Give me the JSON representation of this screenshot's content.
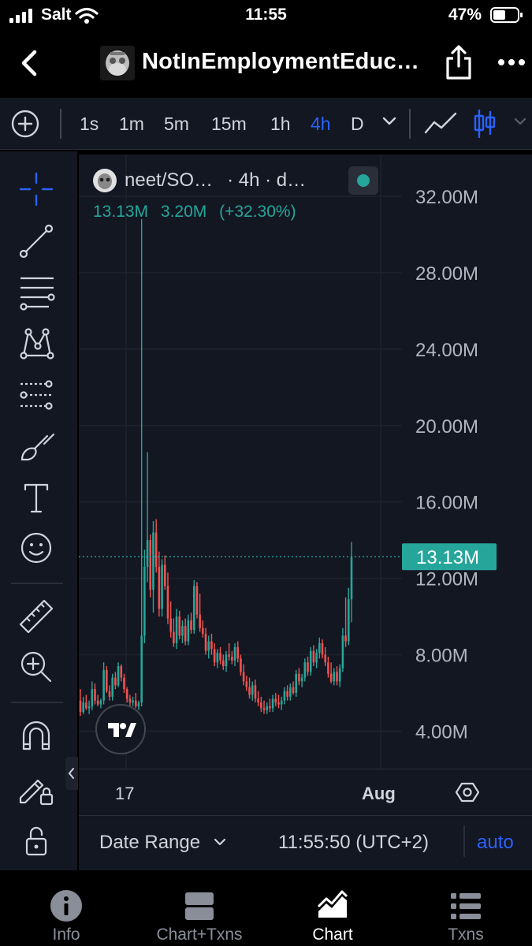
{
  "status_bar": {
    "carrier": "Salt",
    "time": "11:55",
    "battery_percent": "47%"
  },
  "header": {
    "title": "NotInEmploymentEduc…",
    "back_icon": "chevron-left-icon",
    "share_icon": "share-icon",
    "more_icon": "more-icon"
  },
  "toolbar": {
    "intervals": [
      "1s",
      "1m",
      "5m",
      "15m",
      "1h",
      "4h",
      "D"
    ],
    "active_interval": "4h"
  },
  "legend": {
    "symbol": "neet/SO…",
    "meta": "· 4h · d…",
    "ohlc": [
      "13.13M",
      "3.20M",
      "(+32.30%)"
    ]
  },
  "chart_data": {
    "type": "candlestick",
    "y_ticks": [
      "32.00M",
      "28.00M",
      "24.00M",
      "20.00M",
      "16.00M",
      "12.00M",
      "8.00M",
      "4.00M"
    ],
    "x_ticks": [
      "17",
      "Aug"
    ],
    "last_price_label": "13.13M",
    "last_price": 13.13,
    "ylim": [
      1.5,
      33.5
    ],
    "up_color": "#26a69a",
    "down_color": "#ef5350",
    "candles": [
      [
        5.6,
        6.2,
        4.8,
        5.0
      ],
      [
        5.0,
        5.8,
        4.9,
        5.5
      ],
      [
        5.5,
        5.9,
        5.1,
        5.2
      ],
      [
        5.2,
        5.6,
        4.9,
        5.3
      ],
      [
        5.3,
        6.6,
        5.1,
        6.2
      ],
      [
        6.2,
        6.5,
        5.4,
        5.6
      ],
      [
        5.6,
        5.9,
        5.3,
        5.4
      ],
      [
        5.4,
        5.7,
        5.2,
        5.6
      ],
      [
        5.6,
        7.6,
        5.4,
        7.2
      ],
      [
        7.2,
        7.4,
        6.0,
        6.1
      ],
      [
        6.1,
        6.4,
        5.6,
        5.8
      ],
      [
        5.8,
        7.0,
        5.6,
        6.8
      ],
      [
        6.8,
        7.1,
        6.2,
        6.4
      ],
      [
        6.4,
        7.6,
        6.3,
        7.4
      ],
      [
        7.4,
        7.5,
        6.6,
        6.8
      ],
      [
        6.8,
        7.0,
        6.0,
        6.2
      ],
      [
        6.2,
        6.3,
        5.5,
        5.7
      ],
      [
        5.7,
        5.9,
        5.2,
        5.5
      ],
      [
        5.5,
        5.8,
        5.3,
        5.6
      ],
      [
        5.6,
        6.0,
        5.2,
        5.3
      ],
      [
        5.3,
        5.6,
        5.1,
        5.5
      ],
      [
        5.5,
        30.8,
        5.3,
        9.0
      ],
      [
        9.0,
        13.5,
        8.6,
        12.6
      ],
      [
        12.6,
        18.6,
        11.8,
        14.0
      ],
      [
        14.0,
        14.3,
        11.0,
        11.4
      ],
      [
        11.4,
        15.0,
        10.2,
        14.4
      ],
      [
        14.4,
        15.1,
        12.3,
        12.6
      ],
      [
        12.6,
        13.4,
        10.0,
        10.4
      ],
      [
        10.4,
        13.0,
        10.0,
        12.7
      ],
      [
        12.7,
        13.2,
        11.4,
        11.6
      ],
      [
        11.6,
        12.3,
        9.6,
        9.9
      ],
      [
        9.9,
        10.8,
        8.9,
        9.2
      ],
      [
        9.2,
        9.9,
        8.4,
        8.6
      ],
      [
        8.6,
        10.4,
        8.3,
        10.0
      ],
      [
        10.0,
        10.3,
        8.8,
        9.0
      ],
      [
        9.0,
        9.8,
        8.6,
        9.5
      ],
      [
        9.5,
        9.9,
        8.5,
        8.7
      ],
      [
        8.7,
        10.1,
        8.5,
        9.8
      ],
      [
        9.8,
        10.2,
        9.1,
        9.3
      ],
      [
        9.3,
        11.9,
        9.1,
        11.6
      ],
      [
        11.6,
        11.8,
        9.9,
        10.1
      ],
      [
        10.1,
        11.2,
        9.2,
        9.4
      ],
      [
        9.4,
        9.8,
        8.9,
        9.1
      ],
      [
        9.1,
        9.4,
        8.0,
        8.2
      ],
      [
        8.2,
        9.0,
        7.8,
        8.7
      ],
      [
        8.7,
        9.1,
        8.0,
        8.3
      ],
      [
        8.3,
        8.6,
        7.4,
        7.6
      ],
      [
        7.6,
        8.3,
        7.3,
        8.1
      ],
      [
        8.1,
        8.4,
        7.5,
        7.7
      ],
      [
        7.7,
        8.0,
        7.2,
        7.4
      ],
      [
        7.4,
        8.2,
        7.1,
        8.0
      ],
      [
        8.0,
        8.6,
        7.7,
        7.9
      ],
      [
        7.9,
        8.2,
        7.5,
        7.7
      ],
      [
        7.7,
        8.6,
        7.4,
        8.4
      ],
      [
        8.4,
        8.7,
        7.6,
        7.8
      ],
      [
        7.8,
        8.0,
        6.9,
        7.1
      ],
      [
        7.1,
        7.5,
        6.4,
        6.6
      ],
      [
        6.6,
        6.9,
        6.1,
        6.3
      ],
      [
        6.3,
        6.8,
        5.7,
        5.9
      ],
      [
        5.9,
        6.6,
        5.6,
        6.4
      ],
      [
        6.4,
        6.7,
        5.5,
        5.7
      ],
      [
        5.7,
        6.1,
        5.3,
        5.5
      ],
      [
        5.5,
        5.8,
        5.0,
        5.2
      ],
      [
        5.2,
        5.6,
        4.9,
        5.1
      ],
      [
        5.1,
        5.5,
        4.9,
        5.3
      ],
      [
        5.3,
        5.7,
        5.0,
        5.2
      ],
      [
        5.2,
        5.9,
        5.0,
        5.7
      ],
      [
        5.7,
        6.0,
        5.3,
        5.5
      ],
      [
        5.5,
        5.9,
        5.2,
        5.4
      ],
      [
        5.4,
        5.8,
        5.1,
        5.6
      ],
      [
        5.6,
        6.3,
        5.4,
        6.1
      ],
      [
        6.1,
        6.4,
        5.6,
        5.8
      ],
      [
        5.8,
        6.5,
        5.6,
        6.3
      ],
      [
        6.3,
        6.6,
        5.9,
        6.0
      ],
      [
        6.0,
        7.2,
        5.8,
        7.0
      ],
      [
        7.0,
        7.3,
        6.4,
        6.6
      ],
      [
        6.6,
        7.0,
        6.3,
        6.8
      ],
      [
        6.8,
        7.8,
        6.6,
        7.6
      ],
      [
        7.6,
        7.9,
        6.9,
        7.1
      ],
      [
        7.1,
        8.4,
        6.9,
        8.2
      ],
      [
        8.2,
        8.5,
        7.4,
        7.6
      ],
      [
        7.6,
        8.3,
        7.3,
        8.1
      ],
      [
        8.1,
        8.9,
        7.8,
        8.6
      ],
      [
        8.6,
        8.8,
        7.8,
        8.0
      ],
      [
        8.0,
        8.4,
        7.4,
        7.6
      ],
      [
        7.6,
        7.9,
        6.8,
        7.0
      ],
      [
        7.0,
        7.6,
        6.5,
        6.6
      ],
      [
        6.6,
        7.3,
        6.4,
        7.1
      ],
      [
        7.1,
        7.4,
        6.4,
        6.6
      ],
      [
        6.6,
        7.5,
        6.3,
        7.3
      ],
      [
        7.3,
        9.4,
        7.1,
        9.0
      ],
      [
        9.0,
        11.0,
        8.4,
        8.7
      ],
      [
        8.7,
        11.5,
        8.5,
        10.9
      ],
      [
        10.9,
        13.9,
        9.7,
        13.13
      ]
    ]
  },
  "left_tools": [
    {
      "name": "crosshair-icon"
    },
    {
      "name": "trend-line-icon"
    },
    {
      "name": "fib-retracement-icon"
    },
    {
      "name": "pattern-icon"
    },
    {
      "name": "prediction-icon"
    },
    {
      "name": "brush-icon"
    },
    {
      "name": "text-icon"
    },
    {
      "name": "emoji-icon"
    },
    {
      "name": "ruler-icon"
    },
    {
      "name": "zoom-in-icon"
    },
    {
      "name": "magnet-icon"
    },
    {
      "name": "lock-drawing-icon"
    },
    {
      "name": "lock-icon"
    }
  ],
  "bottom_bar": {
    "date_range_label": "Date Range",
    "clock": "11:55:50 (UTC+2)",
    "auto_label": "auto"
  },
  "tabs": [
    {
      "label": "Info",
      "icon": "info-icon",
      "active": false
    },
    {
      "label": "Chart+Txns",
      "icon": "split-view-icon",
      "active": false
    },
    {
      "label": "Chart",
      "icon": "chart-icon",
      "active": true
    },
    {
      "label": "Txns",
      "icon": "list-icon",
      "active": false
    }
  ],
  "colors": {
    "accent_blue": "#2962ff",
    "up_green": "#26a69a",
    "down_red": "#ef5350",
    "panel_bg": "#131722"
  }
}
